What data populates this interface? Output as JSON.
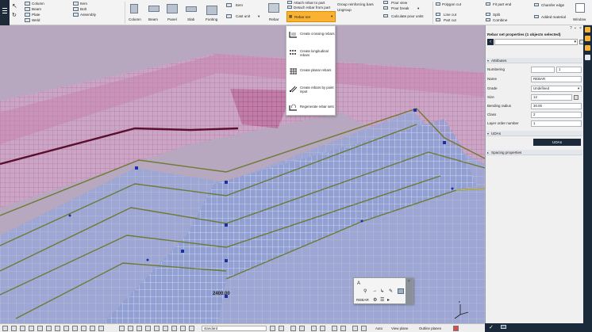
{
  "ribbon": {
    "concrete_small": [
      "Column",
      "Beam",
      "Plate",
      "Weld"
    ],
    "misc_small": [
      "Item",
      "Bolt",
      "Assembly"
    ],
    "concrete_big": [
      "Column",
      "Beam",
      "Panel",
      "Slab",
      "Footing"
    ],
    "item_label": "Item",
    "cast_unit_label": "Cast unit",
    "rebar_label": "Rebar",
    "rebar_set_label": "Rebar set",
    "attach_label": "Attach rebar to part",
    "detach_label": "Detach rebar from part",
    "group_label": "Group reinforcing bars",
    "ungroup_label": "Ungroup",
    "pour_view_label": "Pour view",
    "pour_break_label": "Pour break",
    "calc_pour_label": "Calculate pour units",
    "polygon_cut_label": "Polygon cut",
    "line_cut_label": "Line cut",
    "part_cut_label": "Part cut",
    "fit_part_end_label": "Fit part end",
    "split_label": "Split",
    "combine_label": "Combine",
    "chamfer_label": "Chamfer edge",
    "added_material_label": "Added material",
    "window_label": "Window"
  },
  "dropdown": {
    "items": [
      "Create crossing rebars",
      "Create longitudinal rebars",
      "Create planar rebars",
      "Create rebars by point input",
      "Regenerate rebar sets"
    ]
  },
  "panel": {
    "title": "Rebar set properties (1 objects selected)",
    "attributes_header": "Attributes",
    "uda_header": "UDAs",
    "uda_button": "UDAs",
    "spacing_header": "Spacing properties",
    "fields": {
      "numbering_label": "Numbering",
      "numbering_value": "1",
      "name_label": "Name",
      "name_value": "REBAR",
      "grade_label": "Grade",
      "grade_value": "Undefined",
      "size_label": "Size",
      "size_value": "12",
      "bending_label": "Bending radius",
      "bending_value": "30.00",
      "class_label": "Class",
      "class_value": "2",
      "layer_label": "Layer order number",
      "layer_value": "1"
    }
  },
  "viewport": {
    "dimension_label": "2400.00"
  },
  "toolbox": {
    "label": "REBAR"
  },
  "statusbar": {
    "view_filter": "standard",
    "snap_mode": "Auto",
    "plane_mode": "View plane",
    "outline_mode": "Outline planes"
  },
  "colors": {
    "accent": "#f9b233",
    "dark": "#1d2a3a",
    "selected_rebar": "#a8b4dc",
    "rebar_pink": "#c75d8a"
  }
}
